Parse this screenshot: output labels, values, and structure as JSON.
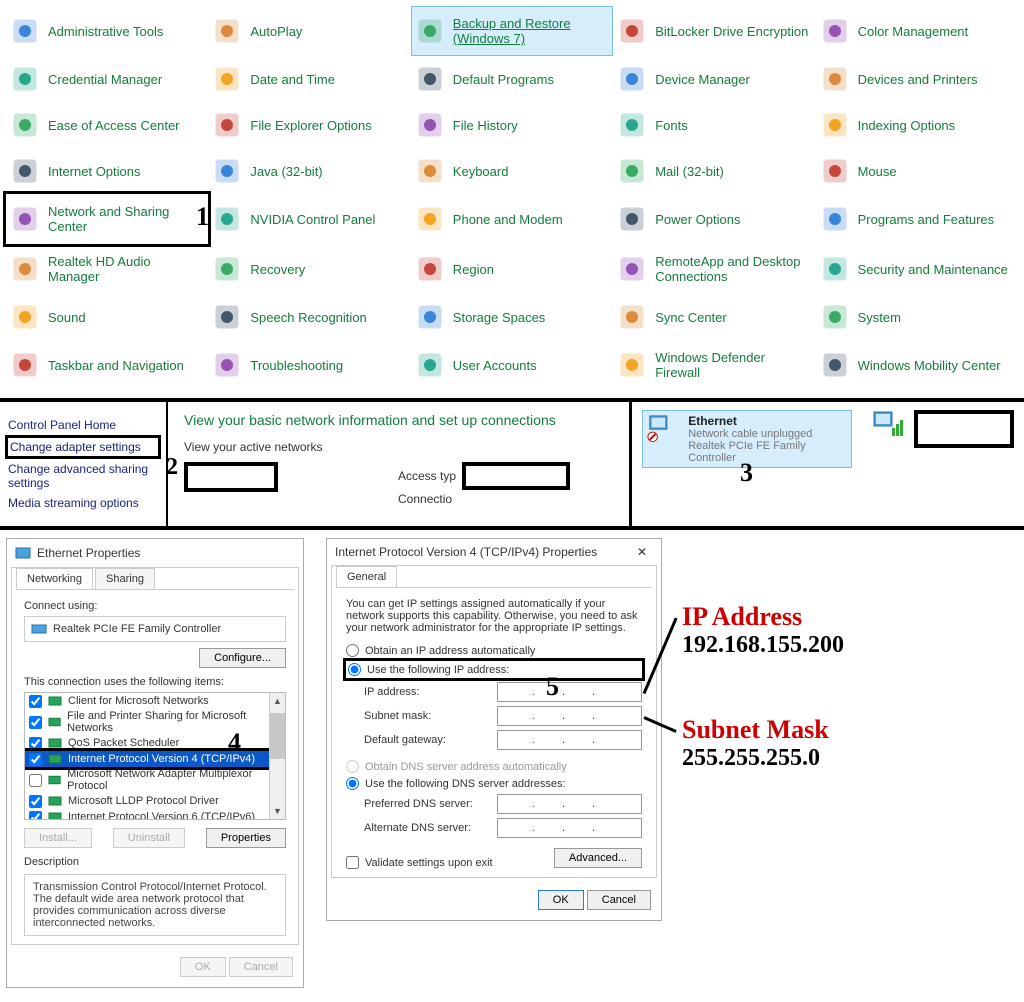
{
  "control_panel": {
    "items": [
      {
        "label": "Administrative Tools",
        "icon": "admin-tools-icon"
      },
      {
        "label": "AutoPlay",
        "icon": "autoplay-icon"
      },
      {
        "label": "Backup and Restore (Windows 7)",
        "icon": "backup-icon",
        "selected": true
      },
      {
        "label": "BitLocker Drive Encryption",
        "icon": "bitlocker-icon"
      },
      {
        "label": "Color Management",
        "icon": "color-mgmt-icon"
      },
      {
        "label": "Credential Manager",
        "icon": "credential-icon"
      },
      {
        "label": "Date and Time",
        "icon": "datetime-icon"
      },
      {
        "label": "Default Programs",
        "icon": "default-programs-icon"
      },
      {
        "label": "Device Manager",
        "icon": "device-mgr-icon"
      },
      {
        "label": "Devices and Printers",
        "icon": "devices-printers-icon"
      },
      {
        "label": "Ease of Access Center",
        "icon": "ease-access-icon"
      },
      {
        "label": "File Explorer Options",
        "icon": "file-explorer-icon"
      },
      {
        "label": "File History",
        "icon": "file-history-icon"
      },
      {
        "label": "Fonts",
        "icon": "fonts-icon"
      },
      {
        "label": "Indexing Options",
        "icon": "indexing-icon"
      },
      {
        "label": "Internet Options",
        "icon": "internet-options-icon"
      },
      {
        "label": "Java (32-bit)",
        "icon": "java-icon"
      },
      {
        "label": "Keyboard",
        "icon": "keyboard-icon"
      },
      {
        "label": "Mail (32-bit)",
        "icon": "mail-icon"
      },
      {
        "label": "Mouse",
        "icon": "mouse-icon"
      },
      {
        "label": "Network and Sharing Center",
        "icon": "network-sharing-icon",
        "highlight": true,
        "number": "1"
      },
      {
        "label": "NVIDIA Control Panel",
        "icon": "nvidia-icon"
      },
      {
        "label": "Phone and Modem",
        "icon": "phone-modem-icon"
      },
      {
        "label": "Power Options",
        "icon": "power-icon"
      },
      {
        "label": "Programs and Features",
        "icon": "programs-icon"
      },
      {
        "label": "Realtek HD Audio Manager",
        "icon": "realtek-icon"
      },
      {
        "label": "Recovery",
        "icon": "recovery-icon"
      },
      {
        "label": "Region",
        "icon": "region-icon"
      },
      {
        "label": "RemoteApp and Desktop Connections",
        "icon": "remoteapp-icon"
      },
      {
        "label": "Security and Maintenance",
        "icon": "security-icon"
      },
      {
        "label": "Sound",
        "icon": "sound-icon"
      },
      {
        "label": "Speech Recognition",
        "icon": "speech-icon"
      },
      {
        "label": "Storage Spaces",
        "icon": "storage-icon"
      },
      {
        "label": "Sync Center",
        "icon": "sync-icon"
      },
      {
        "label": "System",
        "icon": "system-icon"
      },
      {
        "label": "Taskbar and Navigation",
        "icon": "taskbar-icon"
      },
      {
        "label": "Troubleshooting",
        "icon": "troubleshoot-icon"
      },
      {
        "label": "User Accounts",
        "icon": "user-accounts-icon"
      },
      {
        "label": "Windows Defender Firewall",
        "icon": "firewall-icon"
      },
      {
        "label": "Windows Mobility Center",
        "icon": "mobility-icon"
      }
    ]
  },
  "network_center": {
    "side": {
      "home": "Control Panel Home",
      "change_adapter": "Change adapter settings",
      "change_advanced": "Change advanced sharing settings",
      "media": "Media streaming options",
      "number": "2"
    },
    "body": {
      "heading": "View your basic network information and set up connections",
      "sub": "View your active networks",
      "access_type": "Access typ",
      "connections": "Connectio"
    }
  },
  "adapters": {
    "ethernet": {
      "name": "Ethernet",
      "status": "Network cable unplugged",
      "device": "Realtek PCIe FE Family Controller"
    },
    "number": "3"
  },
  "ethernet_props": {
    "title": "Ethernet Properties",
    "tab_networking": "Networking",
    "tab_sharing": "Sharing",
    "connect_using": "Connect using:",
    "adapter": "Realtek PCIe FE Family Controller",
    "configure": "Configure...",
    "uses_label": "This connection uses the following items:",
    "items": [
      {
        "label": "Client for Microsoft Networks",
        "checked": true
      },
      {
        "label": "File and Printer Sharing for Microsoft Networks",
        "checked": true
      },
      {
        "label": "QoS Packet Scheduler",
        "checked": true
      },
      {
        "label": "Internet Protocol Version 4 (TCP/IPv4)",
        "checked": true,
        "selected": true
      },
      {
        "label": "Microsoft Network Adapter Multiplexor Protocol",
        "checked": false
      },
      {
        "label": "Microsoft LLDP Protocol Driver",
        "checked": true
      },
      {
        "label": "Internet Protocol Version 6 (TCP/IPv6)",
        "checked": true
      }
    ],
    "install": "Install...",
    "uninstall": "Uninstall",
    "properties": "Properties",
    "desc_label": "Description",
    "desc_text": "Transmission Control Protocol/Internet Protocol. The default wide area network protocol that provides communication across diverse interconnected networks.",
    "ok": "OK",
    "cancel": "Cancel",
    "number": "4"
  },
  "ipv4_props": {
    "title": "Internet Protocol Version 4 (TCP/IPv4) Properties",
    "tab_general": "General",
    "help": "You can get IP settings assigned automatically if your network supports this capability. Otherwise, you need to ask your network administrator for the appropriate IP settings.",
    "radio_auto": "Obtain an IP address automatically",
    "radio_manual": "Use the following IP address:",
    "ip_label": "IP address:",
    "subnet_label": "Subnet mask:",
    "gateway_label": "Default gateway:",
    "dns_auto": "Obtain DNS server address automatically",
    "dns_manual": "Use the following DNS server addresses:",
    "pref_dns": "Preferred DNS server:",
    "alt_dns": "Alternate DNS server:",
    "validate": "Validate settings upon exit",
    "advanced": "Advanced...",
    "ok": "OK",
    "cancel": "Cancel",
    "close_x": "✕",
    "number": "5",
    "ip_dots": ". . .",
    "dns_dots": ". . ."
  },
  "annotations": {
    "ip_title": "IP Address",
    "ip_value": "192.168.155.200",
    "subnet_title": "Subnet Mask",
    "subnet_value": "255.255.255.0"
  }
}
